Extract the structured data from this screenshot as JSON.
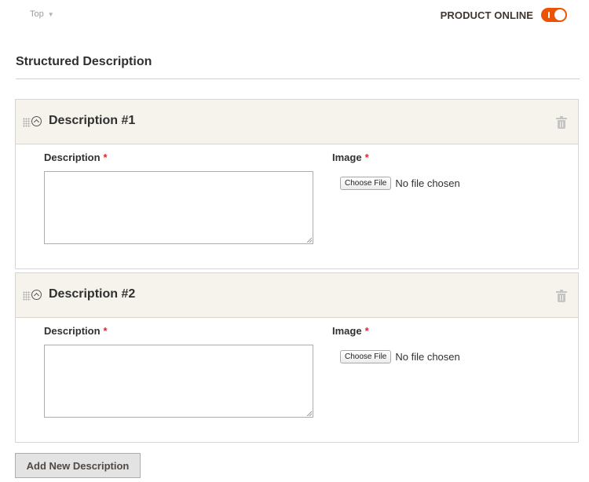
{
  "header": {
    "scope_label": "Top",
    "product_online_label": "PRODUCT ONLINE",
    "product_online_enabled": true,
    "toggle_on_color": "#eb5202"
  },
  "section": {
    "title": "Structured Description"
  },
  "descriptions": [
    {
      "title": "Description #1",
      "description_label": "Description",
      "description_value": "",
      "image_label": "Image",
      "required_marker": "*",
      "choose_file_label": "Choose File",
      "file_status": "No file chosen"
    },
    {
      "title": "Description #2",
      "description_label": "Description",
      "description_value": "",
      "image_label": "Image",
      "required_marker": "*",
      "choose_file_label": "Choose File",
      "file_status": "No file chosen"
    }
  ],
  "add_button_label": "Add New Description",
  "icons": {
    "drag": "drag-handle-icon",
    "collapse": "chevron-up-circle-icon",
    "delete": "trash-icon",
    "scope_caret": "caret-down-icon"
  }
}
